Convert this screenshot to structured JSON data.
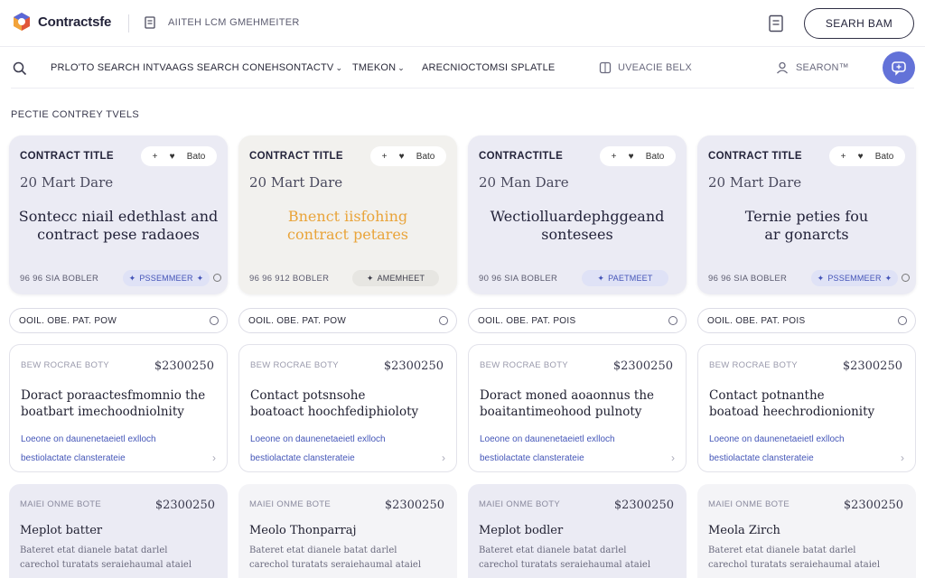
{
  "header": {
    "brand": "Contractsfe",
    "breadcrumb": "AIITEH LCM GMEHMEITER",
    "search_button": "SEARH BAM"
  },
  "toolbar": {
    "items": [
      "PRLO'TO SEARCH INTVAAGS SEARCH CONEHSONTACTV",
      "TMEKON",
      "ARECNIOCTOMSI SPLATLE",
      "UVEACIE BELX",
      "SEARON™"
    ],
    "icons": [
      "search-icon",
      "chevron-down-icon",
      "grid-icon",
      "user-icon",
      "chat-icon"
    ]
  },
  "section_title": "PECTIE CONTREY TVELS",
  "hero_cards": [
    {
      "title": "CONTRACT TITLE",
      "pill_label": "Bato",
      "date": "20 Mart Dare",
      "body_line1": "Sontecc niail edethlast and",
      "body_line2": "contract pese radaoes",
      "meta": "96 96 SIA BOBLER",
      "badge": "PSSEMMEER",
      "style": "lavender"
    },
    {
      "title": "CONTRACT TITLE",
      "pill_label": "Bato",
      "date": "20 Mart Dare",
      "body_line1": "Bnenct iisfohing",
      "body_line2": "contract petares",
      "meta": "96 96 912 BOBLER",
      "badge": "AMEMHEET",
      "style": "cream"
    },
    {
      "title": "CONTRACTITLE",
      "pill_label": "Bato",
      "date": "20 Man Dare",
      "body_line1": "Wectiolluardephggeand",
      "body_line2": "sontesees",
      "meta": "90 96 SIA BOBLER",
      "badge": "PAETMEET",
      "style": "lavender"
    },
    {
      "title": "CONTRACT TITLE",
      "pill_label": "Bato",
      "date": "20 Mart Dare",
      "body_line1": "Ternie peties fou",
      "body_line2": "ar gonarcts",
      "meta": "96 96 SIA BOBLER",
      "badge": "PSSEMMEER",
      "style": "lavender"
    }
  ],
  "strips": [
    "OOIL. OBE. PAT. POW",
    "OOIL. OBE. PAT. POW",
    "OOIL. OBE. PAT. POIS",
    "OOIL. OBE. PAT. POIS"
  ],
  "detail_cards": [
    {
      "kicker": "BEW ROCRAE BOTY",
      "price": "$2300250",
      "title1": "Doract poraactesfmomnio the",
      "title2": "boatbart imechoodniolnity",
      "link1": "Loeone on daunenetaeietl exlloch",
      "link2": "bestiolactate clansterateie"
    },
    {
      "kicker": "BEW ROCRAE BOTY",
      "price": "$2300250",
      "title1": "Contact potsnsohe",
      "title2": "boatoact hoochfediphioloty",
      "link1": "Loeone on daunenetaeietl exlloch",
      "link2": "bestiolactate clansterateie"
    },
    {
      "kicker": "BEW ROCRAE BOTY",
      "price": "$2300250",
      "title1": "Doract moned aoaonnus the",
      "title2": "boaitantimeohood pulnoty",
      "link1": "Loeone on daunenetaeietl exlloch",
      "link2": "bestiolactate clansterateie"
    },
    {
      "kicker": "BEW ROCRAE BOTY",
      "price": "$2300250",
      "title1": "Contact potnanthe",
      "title2": "boatoad heechrodionionity",
      "link1": "Loeone on daunenetaeietl exlloch",
      "link2": "bestiolactate clansterateie"
    }
  ],
  "bottom_cards": [
    {
      "kicker": "MAIEI ONME BOTE",
      "price": "$2300250",
      "title": "Meplot batter",
      "desc1": "Bateret etat dianele batat darlel",
      "desc2": "carechol turatats seraiehaumal ataiel"
    },
    {
      "kicker": "MAIEI ONME BOTE",
      "price": "$2300250",
      "title": "Meolo Thonparraj",
      "desc1": "Bateret etat dianele batat darlel",
      "desc2": "carechol turatats seraiehaumal ataiel"
    },
    {
      "kicker": "MAIEI ONME BOTY",
      "price": "$2300250",
      "title": "Meplot bodler",
      "desc1": "Bateret etat dianele batat darlel",
      "desc2": "carechol turatats seraiehaumal ataiel"
    },
    {
      "kicker": "MAIEI ONME BOTE",
      "price": "$2300250",
      "title": "Meola Zirch",
      "desc1": "Bateret etat dianele batat darlel",
      "desc2": "carechol turatats seraiehaumal ataiel"
    }
  ],
  "colors": {
    "accent": "#6372d8",
    "link": "#4456b8",
    "hero_lavender": "#ebebf4",
    "hero_cream": "#f2f1ee",
    "highlight_text": "#e9a43a"
  }
}
